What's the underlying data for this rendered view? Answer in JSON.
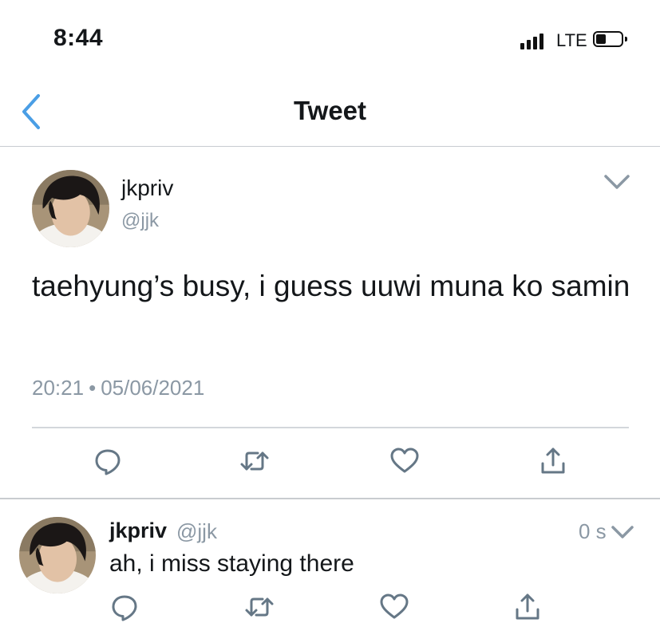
{
  "status_bar": {
    "time": "8:44",
    "network": "LTE",
    "icons": [
      "signal-icon",
      "battery-icon"
    ]
  },
  "nav": {
    "title": "Tweet",
    "back_icon": "chevron-left-icon",
    "accent_color": "#4a9ee5"
  },
  "main_tweet": {
    "display_name": "jkpriv",
    "handle": "@jjk",
    "text": "taehyung’s busy, i guess uuwi muna ko samin",
    "time": "20:21",
    "separator": "•",
    "date": "05/06/2021",
    "menu_icon": "chevron-down-icon",
    "actions": [
      "reply-icon",
      "retweet-icon",
      "like-icon",
      "share-icon"
    ]
  },
  "reply_tweet": {
    "display_name": "jkpriv",
    "handle": "@jjk",
    "time": "0 s",
    "text": "ah, i miss staying there",
    "menu_icon": "chevron-down-icon",
    "actions": [
      "reply-icon",
      "retweet-icon",
      "like-icon",
      "share-icon"
    ]
  },
  "colors": {
    "text_primary": "#14171a",
    "text_secondary": "#8b98a4",
    "icon_gray": "#657786",
    "divider": "#c8ccd0"
  }
}
